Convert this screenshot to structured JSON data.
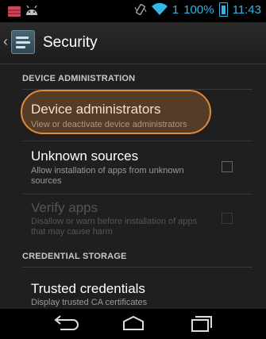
{
  "status_bar": {
    "notification_icons": [
      "message-icon",
      "android-icon"
    ],
    "right_icons": [
      "vibrate-icon",
      "wifi-icon"
    ],
    "signal_count": "1",
    "battery_percent": "100%",
    "time": "11:43",
    "accent": "#33b5e5"
  },
  "action_bar": {
    "title": "Security"
  },
  "sections": {
    "device_admin_header": "DEVICE ADMINISTRATION",
    "credential_header": "CREDENTIAL STORAGE"
  },
  "prefs": {
    "device_admins": {
      "title": "Device administrators",
      "summary": "View or deactivate device administrators"
    },
    "unknown_sources": {
      "title": "Unknown sources",
      "summary": "Allow installation of apps from unknown sources",
      "checked": false
    },
    "verify_apps": {
      "title": "Verify apps",
      "summary": "Disallow or warn before installation of apps that may cause harm",
      "checked": false,
      "enabled": false
    },
    "trusted_credentials": {
      "title": "Trusted credentials",
      "summary": "Display trusted CA certificates"
    }
  },
  "highlight_color": "#e08a3a",
  "nav": [
    "back-icon",
    "home-icon",
    "recents-icon"
  ]
}
